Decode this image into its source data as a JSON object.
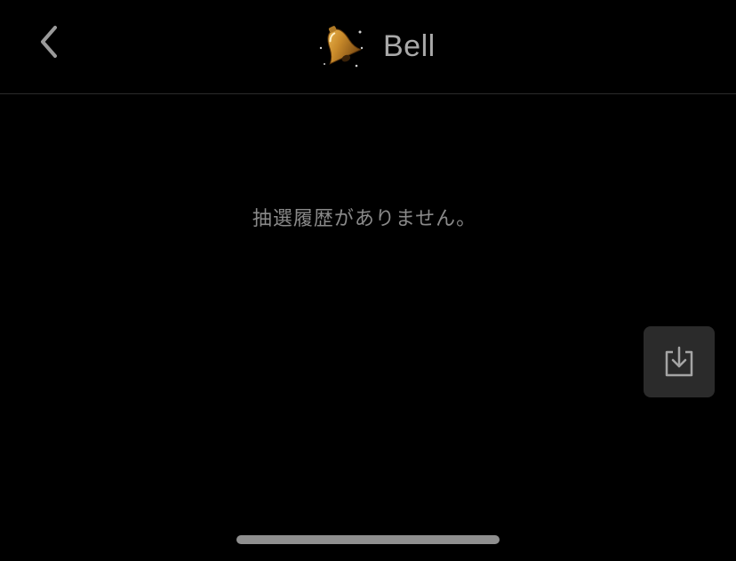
{
  "header": {
    "back_icon": "chevron-left-icon",
    "title_icon": "bell-icon",
    "title": "Bell"
  },
  "main": {
    "empty_message": "抽選履歴がありません。"
  },
  "download_button": {
    "icon": "download-tray-icon"
  },
  "colors": {
    "background": "#000000",
    "title_text": "#a9a9a9",
    "message_text": "#8a8a8a",
    "button_bg": "#2b2b2b",
    "divider": "#2a2a2a",
    "bell_gold": "#c98a2a"
  }
}
